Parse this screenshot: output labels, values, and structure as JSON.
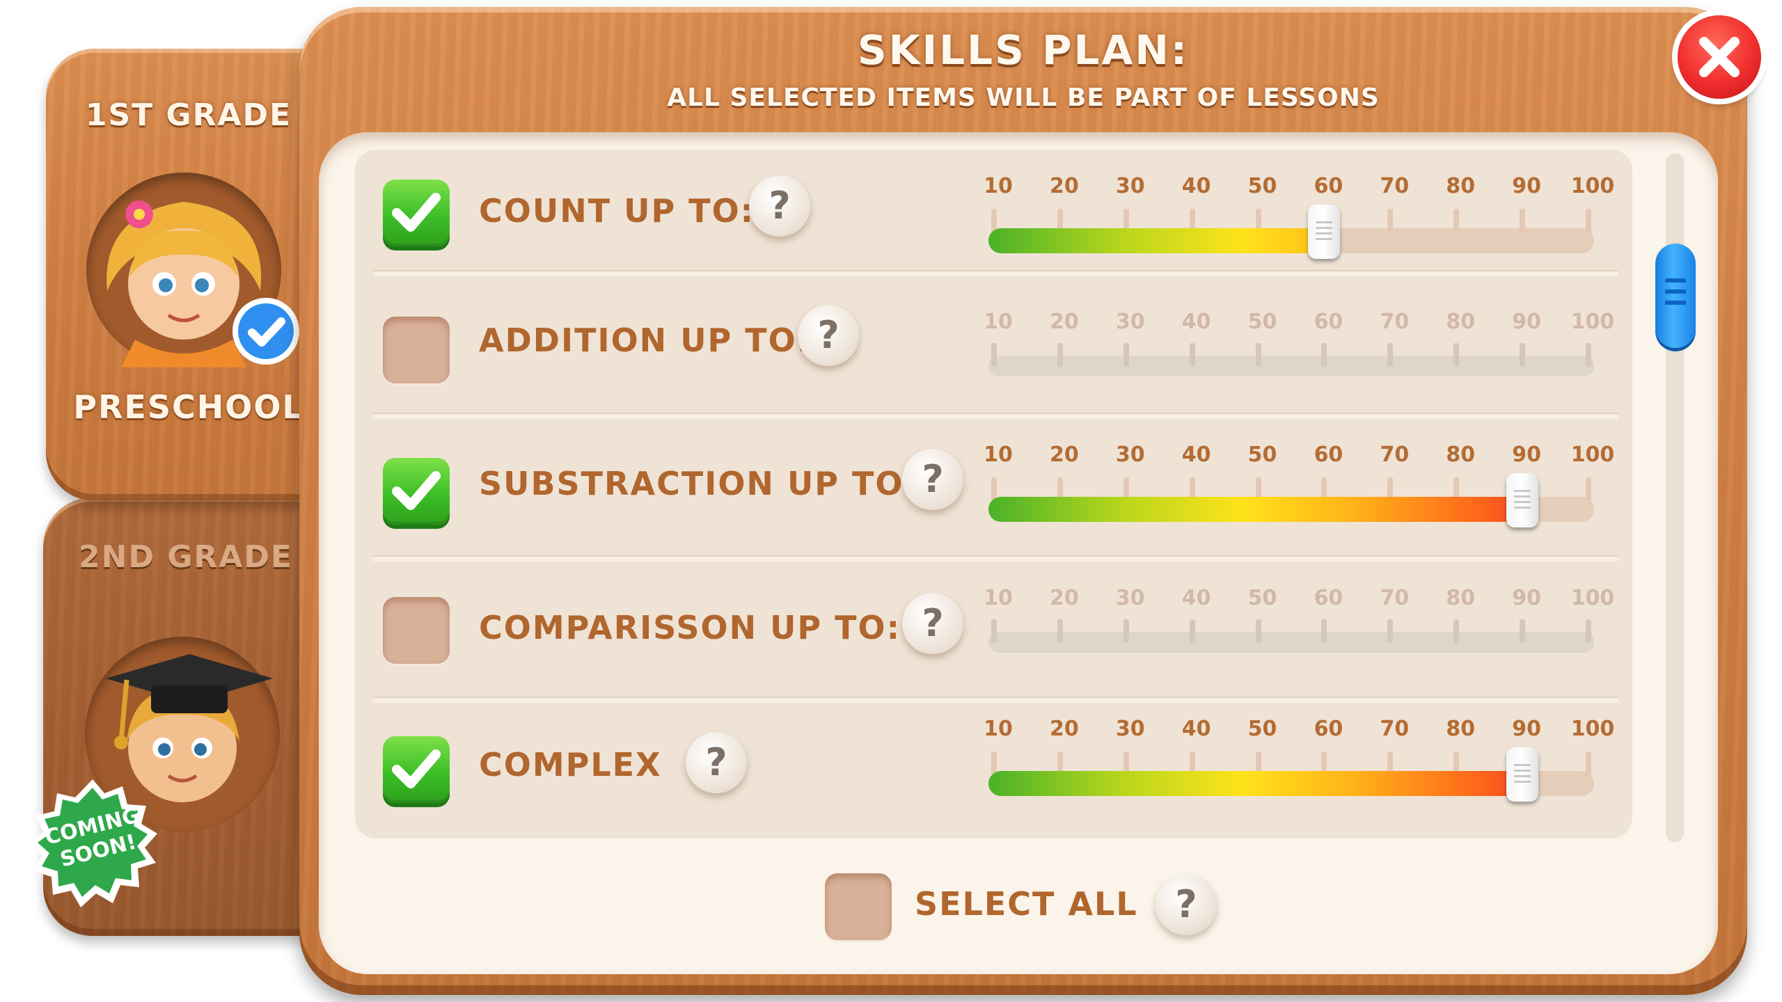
{
  "header": {
    "title": "SKILLS PLAN:",
    "subtitle": "ALL SELECTED ITEMS WILL BE PART OF LESSONS"
  },
  "grades": [
    {
      "tab_label": "1ST GRADE",
      "name": "PRESCHOOL",
      "selected": true
    },
    {
      "tab_label": "2ND GRADE",
      "badge": "COMING SOON!",
      "available": false
    }
  ],
  "skills": [
    {
      "label": "COUNT UP TO:",
      "checked": true,
      "enabled": true,
      "value": 60
    },
    {
      "label": "ADDITION UP TO:",
      "checked": false,
      "enabled": false,
      "value": null
    },
    {
      "label": "SUBSTRACTION UP TO:",
      "checked": true,
      "enabled": true,
      "value": 90
    },
    {
      "label": "COMPARISSON UP TO:",
      "checked": false,
      "enabled": false,
      "value": null
    },
    {
      "label": "COMPLEX",
      "checked": true,
      "enabled": true,
      "value": 90
    }
  ],
  "slider_scale": [
    "10",
    "20",
    "30",
    "40",
    "50",
    "60",
    "70",
    "80",
    "90",
    "100"
  ],
  "help_symbol": "?",
  "select_all": {
    "label": "SELECT ALL",
    "checked": false
  },
  "icons": {
    "close": "close-icon",
    "check": "checkmark-icon",
    "verified": "verified-check-icon",
    "help": "question-mark-icon",
    "graduation": "graduation-cap-icon"
  },
  "colors": {
    "wood": "#d4844a",
    "label_text": "#b0662d",
    "check_green": "#3cbf27",
    "close_red": "#f02d2d",
    "scroll_blue": "#1a82e8"
  }
}
